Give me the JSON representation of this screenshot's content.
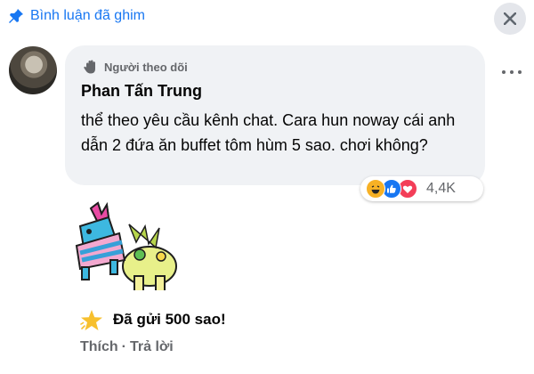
{
  "header": {
    "pinned_label": "Bình luận đã ghim",
    "icons": {
      "pin": "pin-icon",
      "close": "close-icon"
    }
  },
  "comment": {
    "badge": "Người theo dõi",
    "author": "Phan Tấn Trung",
    "text": "thể theo yêu cầu kênh chat. Cara hun noway cái anh dẫn 2 đứa ăn buffet tôm hùm 5 sao. chơi không?",
    "reactions": {
      "types": [
        "haha",
        "like",
        "love"
      ],
      "count": "4,4K"
    },
    "sticker": "pinata-sticker",
    "stars_sent": "Đã gửi 500 sao!",
    "actions": {
      "like": "Thích",
      "separator": "·",
      "reply": "Trả lời"
    }
  },
  "colors": {
    "accent": "#1877f2",
    "bubble": "#f0f2f5",
    "secondary_text": "#65676b",
    "haha": "#f7b125",
    "love": "#f33e58"
  }
}
